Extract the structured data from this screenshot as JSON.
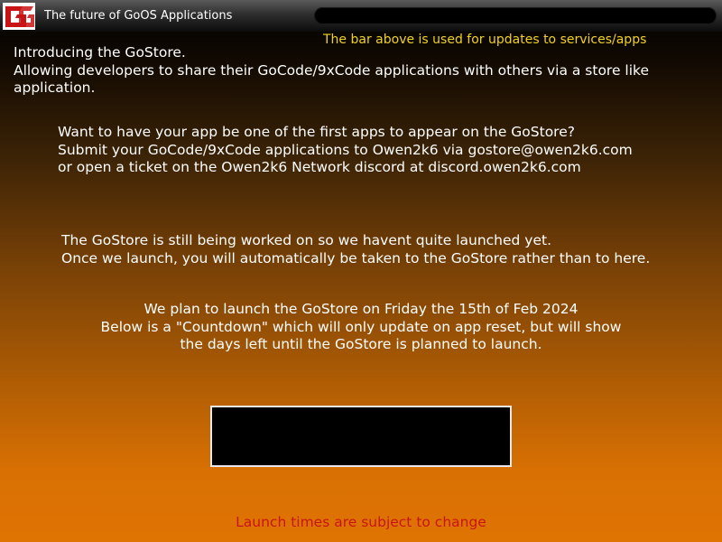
{
  "window": {
    "title": "The future of GoOS Applications",
    "logo_icon": "gostore-logo-icon"
  },
  "updates": {
    "note": "The bar above is used for updates to services/apps"
  },
  "intro": {
    "line1": "Introducing the GoStore.",
    "line2": "Allowing developers to share their GoCode/9xCode applications with others via a store like",
    "line3": "application."
  },
  "submit": {
    "line1": "Want to have your app be one of the first apps to appear on the GoStore?",
    "line2": "Submit your GoCode/9xCode applications to Owen2k6 via gostore@owen2k6.com",
    "line3": "or open a ticket on the Owen2k6 Network discord at discord.owen2k6.com"
  },
  "status": {
    "line1": "The GoStore is still being worked on so we havent quite launched yet.",
    "line2": "Once we launch, you will automatically be taken to the GoStore rather than to here."
  },
  "plan": {
    "line1": "We plan to launch the GoStore on Friday the 15th of Feb 2024",
    "line2": "Below is a \"Countdown\" which will only update on app reset, but will show",
    "line3": "the days left until the GoStore is planned to launch."
  },
  "countdown": {
    "value": ""
  },
  "disclaimer": {
    "text": "Launch times are subject to change"
  },
  "colors": {
    "accent_red": "#c81414",
    "note_yellow": "#f0d21c",
    "bg_top": "#000000",
    "bg_bottom": "#e07403"
  }
}
